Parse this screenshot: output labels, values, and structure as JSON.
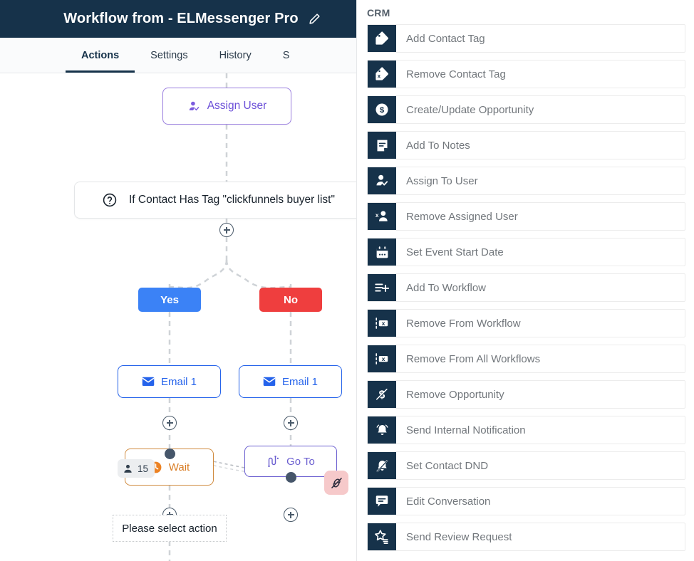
{
  "header": {
    "title": "Workflow from - ELMessenger Pro",
    "edit_icon": "pencil-icon",
    "bg_color": "#16324a"
  },
  "tabs": [
    {
      "label": "Actions",
      "active": true
    },
    {
      "label": "Settings",
      "active": false
    },
    {
      "label": "History",
      "active": false
    },
    {
      "label": "S",
      "active": false
    }
  ],
  "canvas": {
    "nodes": {
      "assign_user": {
        "label": "Assign User",
        "icon": "assign-user-icon",
        "color": "#6b4fd8"
      },
      "condition": {
        "label": "If Contact Has Tag \"clickfunnels buyer list\"",
        "icon": "question-mark-icon"
      },
      "branch_yes": {
        "label": "Yes",
        "color": "#3b82f6"
      },
      "branch_no": {
        "label": "No",
        "color": "#ef3e3e"
      },
      "email_yes": {
        "label": "Email 1",
        "icon": "envelope-icon",
        "color": "#2563eb"
      },
      "email_no": {
        "label": "Email 1",
        "icon": "envelope-icon",
        "color": "#2563eb"
      },
      "wait": {
        "label": "Wait",
        "icon": "clock-icon",
        "color": "#d87b22"
      },
      "goto": {
        "label": "Go To",
        "icon": "goto-icon",
        "color": "#6b5fd0"
      }
    },
    "contact_badge": {
      "count": "15",
      "icon": "person-icon"
    },
    "unlink_chip": {
      "icon": "unlink-icon",
      "color": "#f6c9ca"
    },
    "tooltip": {
      "text": "Please select action"
    },
    "add_buttons": 5
  },
  "right_panel": {
    "title": "CRM",
    "items": [
      {
        "label": "Add Contact Tag",
        "icon": "tag-add-icon"
      },
      {
        "label": "Remove Contact Tag",
        "icon": "tag-remove-icon"
      },
      {
        "label": "Create/Update Opportunity",
        "icon": "dollar-circle-icon"
      },
      {
        "label": "Add To Notes",
        "icon": "note-icon"
      },
      {
        "label": "Assign To User",
        "icon": "user-check-icon"
      },
      {
        "label": "Remove Assigned User",
        "icon": "user-remove-icon"
      },
      {
        "label": "Set Event Start Date",
        "icon": "calendar-icon"
      },
      {
        "label": "Add To Workflow",
        "icon": "list-add-icon"
      },
      {
        "label": "Remove From Workflow",
        "icon": "list-remove-icon"
      },
      {
        "label": "Remove From All Workflows",
        "icon": "list-remove-icon"
      },
      {
        "label": "Remove Opportunity",
        "icon": "dollar-slash-icon"
      },
      {
        "label": "Send Internal Notification",
        "icon": "bell-icon"
      },
      {
        "label": "Set Contact DND",
        "icon": "bell-slash-icon"
      },
      {
        "label": "Edit Conversation",
        "icon": "chat-edit-icon"
      },
      {
        "label": "Send Review Request",
        "icon": "star-review-icon"
      }
    ]
  }
}
